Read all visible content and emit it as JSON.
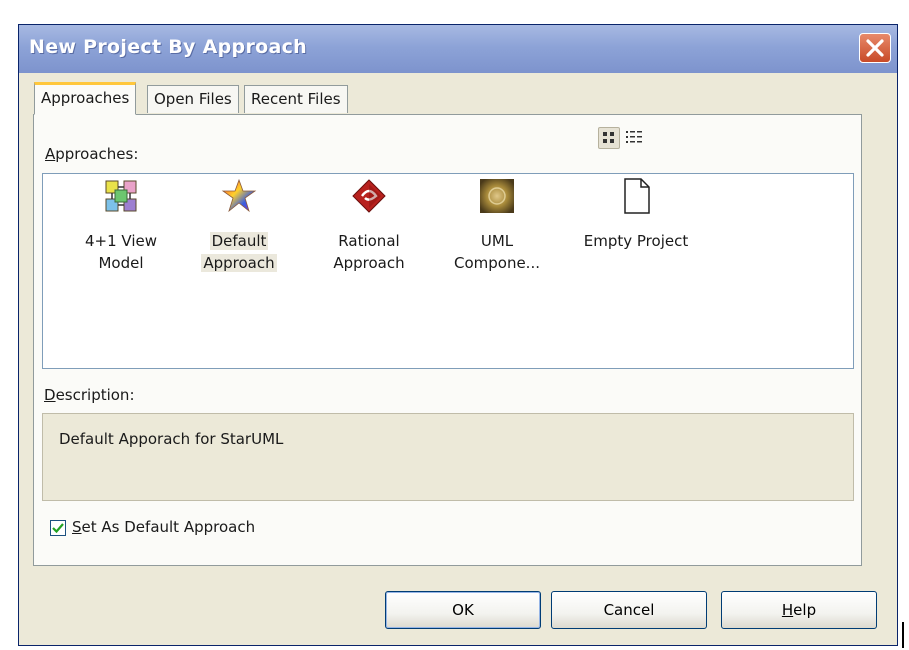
{
  "window": {
    "title": "New Project By Approach"
  },
  "tabs": [
    {
      "label": "Approaches"
    },
    {
      "label": "Open Files"
    },
    {
      "label": "Recent Files"
    }
  ],
  "approaches_label": "Approaches:",
  "approaches_access_key": "A",
  "approaches_label_rest": "pproaches:",
  "view_modes": [
    "large-icons-view",
    "list-view"
  ],
  "items": [
    {
      "line1": "4+1 View",
      "line2": "Model",
      "icon": "4plus1-view-model-icon"
    },
    {
      "line1": "Default",
      "line2": "Approach",
      "icon": "star-icon",
      "selected": true
    },
    {
      "line1": "Rational",
      "line2": "Approach",
      "icon": "rational-icon"
    },
    {
      "line1": "UML",
      "line2": "Compone...",
      "icon": "uml-component-icon"
    },
    {
      "line1": "Empty Project",
      "line2": "",
      "icon": "blank-document-icon"
    }
  ],
  "description": {
    "label_key": "D",
    "label_rest": "escription:",
    "text": "Default Apporach for StarUML"
  },
  "set_default": {
    "checked": true,
    "key": "S",
    "rest": "et As Default Approach"
  },
  "buttons": {
    "ok": "OK",
    "cancel": "Cancel",
    "help_key": "H",
    "help_rest": "elp"
  },
  "colors": {
    "titlebar": "#8da3d7",
    "panel": "#ece9d8",
    "tab_highlight": "#ffc73c",
    "close": "#c84a28"
  }
}
